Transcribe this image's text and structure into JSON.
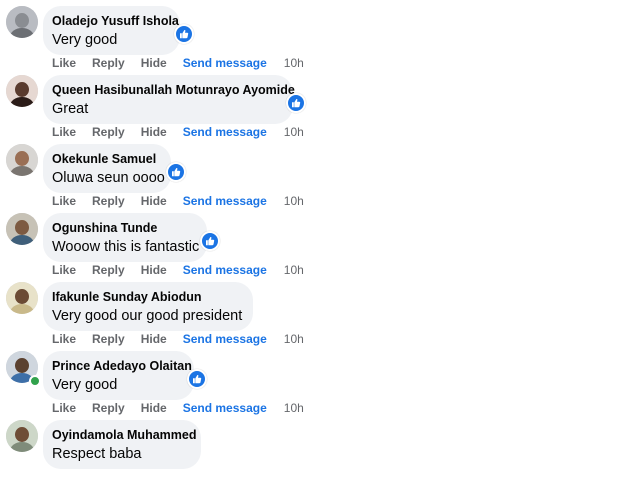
{
  "comments": [
    {
      "author": "Oladejo Yusuff Ishola",
      "text": "Very good",
      "avatar_color": "#b9bcc2",
      "head_color": "#8a8d92",
      "body_color": "#6c6f74"
    },
    {
      "author": "Queen Hasibunallah Motunrayo Ayomide",
      "text": "Great",
      "avatar_color": "#e6d8d2",
      "head_color": "#5a3b2e",
      "body_color": "#2b1c18"
    },
    {
      "author": "Okekunle Samuel",
      "text": "Oluwa seun oooo",
      "avatar_color": "#d8d6d3",
      "head_color": "#9a6f55",
      "body_color": "#7a7570"
    },
    {
      "author": "Ogunshina Tunde",
      "text": "Wooow this is fantastic",
      "avatar_color": "#c7c2b6",
      "head_color": "#7d5a41",
      "body_color": "#3f5f7a"
    },
    {
      "author": "Ifakunle Sunday Abiodun",
      "text": "Very good our good president",
      "avatar_color": "#e8e2c9",
      "head_color": "#6b4a34",
      "body_color": "#c9b98a"
    },
    {
      "author": "Prince Adedayo Olaitan",
      "text": "Very good",
      "avatar_color": "#cfd6de",
      "head_color": "#5b412f",
      "body_color": "#3d6fa8"
    },
    {
      "author": "Oyindamola Muhammed",
      "text": "Respect baba",
      "avatar_color": "#cdd7c8",
      "head_color": "#6e4d36",
      "body_color": "#7f8c7a"
    }
  ],
  "actions": {
    "like": "Like",
    "reply": "Reply",
    "hide": "Hide",
    "send_message": "Send message",
    "time": "10h"
  },
  "colors": {
    "bubble": "#f0f2f5",
    "link_blue": "#1b74e4",
    "muted": "#65676b",
    "online": "#31a24c"
  },
  "icons": {
    "reaction": "thumbs-up-icon"
  }
}
